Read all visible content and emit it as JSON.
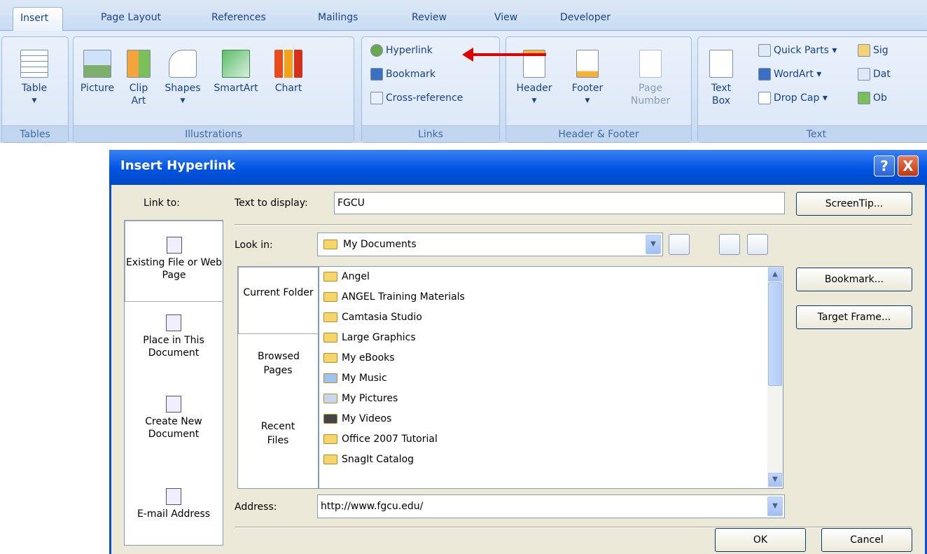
{
  "ribbon": {
    "tabs": [
      "Insert",
      "Page Layout",
      "References",
      "Mailings",
      "Review",
      "View",
      "Developer"
    ],
    "tables": {
      "table_label": "Table",
      "group_label": "Tables"
    },
    "illustrations": {
      "picture": "Picture",
      "clip_art": "Clip Art",
      "shapes": "Shapes",
      "smartart": "SmartArt",
      "chart": "Chart",
      "group_label": "Illustrations"
    },
    "links": {
      "hyperlink": "Hyperlink",
      "bookmark": "Bookmark",
      "cross_reference": "Cross-reference",
      "group_label": "Links"
    },
    "header_footer": {
      "header": "Header",
      "footer": "Footer",
      "page_number": "Page Number",
      "group_label": "Header & Footer"
    },
    "text": {
      "text_box": "Text Box",
      "quick_parts": "Quick Parts",
      "wordart": "WordArt",
      "drop_cap": "Drop Cap",
      "sig": "Sig",
      "dat": "Dat",
      "obj": "Ob",
      "group_label": "Text"
    }
  },
  "dialog": {
    "title": "Insert Hyperlink",
    "help": "?",
    "close": "X",
    "link_to_label": "Link to:",
    "link_to": [
      {
        "label": "Existing File or Web Page",
        "selected": true
      },
      {
        "label": "Place in This Document"
      },
      {
        "label": "Create New Document"
      },
      {
        "label": "E-mail Address"
      }
    ],
    "text_to_display_label": "Text to display:",
    "text_to_display_value": "FGCU",
    "screentip_button": "ScreenTip...",
    "look_in_label": "Look in:",
    "look_in_value": "My Documents",
    "nav": [
      {
        "label": "Current Folder",
        "selected": true
      },
      {
        "label": "Browsed Pages"
      },
      {
        "label": "Recent Files"
      }
    ],
    "files": [
      "Angel",
      "ANGEL Training Materials",
      "Camtasia Studio",
      "Large Graphics",
      "My eBooks",
      "My Music",
      "My Pictures",
      "My Videos",
      "Office 2007 Tutorial",
      "SnagIt Catalog"
    ],
    "bookmark_button": "Bookmark...",
    "target_frame_button": "Target Frame...",
    "address_label": "Address:",
    "address_value": "http://www.fgcu.edu/",
    "ok_button": "OK",
    "cancel_button": "Cancel"
  },
  "colors": {
    "title_bar": "#0054e3",
    "arrow": "#e00000",
    "ribbon_text": "#15428b"
  }
}
